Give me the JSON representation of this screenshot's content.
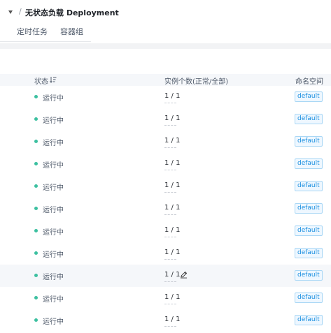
{
  "breadcrumb": {
    "separator": "/",
    "title": "无状态负载 Deployment"
  },
  "tabs": [
    {
      "label": "定时任务"
    },
    {
      "label": "容器组"
    }
  ],
  "table": {
    "columns": {
      "status": "状态",
      "instances": "实例个数(正常/全部)",
      "namespace": "命名空间"
    },
    "rows": [
      {
        "status": "运行中",
        "instances": "1 / 1",
        "namespace": "default"
      },
      {
        "status": "运行中",
        "instances": "1 / 1",
        "namespace": "default"
      },
      {
        "status": "运行中",
        "instances": "1 / 1",
        "namespace": "default"
      },
      {
        "status": "运行中",
        "instances": "1 / 1",
        "namespace": "default"
      },
      {
        "status": "运行中",
        "instances": "1 / 1",
        "namespace": "default"
      },
      {
        "status": "运行中",
        "instances": "1 / 1",
        "namespace": "default"
      },
      {
        "status": "运行中",
        "instances": "1 / 1",
        "namespace": "default"
      },
      {
        "status": "运行中",
        "instances": "1 / 1",
        "namespace": "default"
      },
      {
        "status": "运行中",
        "instances": "1 / 1",
        "namespace": "default"
      },
      {
        "status": "运行中",
        "instances": "1 / 1",
        "namespace": "default"
      },
      {
        "status": "运行中",
        "instances": "1 / 1",
        "namespace": "default"
      }
    ]
  },
  "colors": {
    "status_running": "#3cc0a0",
    "namespace_tag_text": "#1a8fe0",
    "namespace_tag_border": "#a9d7f5",
    "header_bg": "#f5f7fa"
  },
  "icons": {
    "sort": "sort-icon",
    "edit": "pencil-edit-icon",
    "dropdown": "caret-down-icon"
  }
}
